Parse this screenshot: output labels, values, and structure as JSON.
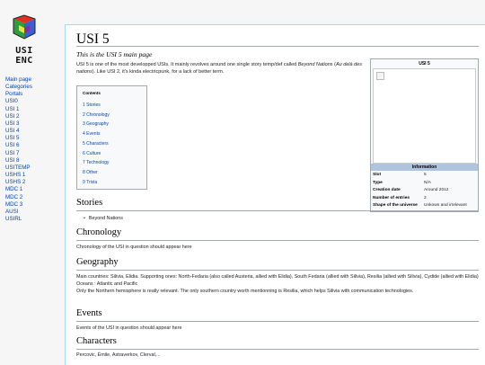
{
  "logo": {
    "line1": "USI",
    "line2": "ENC"
  },
  "nav": [
    "Main page",
    "Categories",
    "Portals",
    "USI0",
    "USI 1",
    "USI 2",
    "USI 3",
    "USI 4",
    "USI 5",
    "USI 6",
    "USI 7",
    "USI 8",
    "USITEMP",
    "USHS 1",
    "USHS 2",
    "MDC 1",
    "MDC 2",
    "MDC 3",
    "AUSI",
    "USIRL"
  ],
  "page": {
    "title": "USI 5",
    "tagline": "This is the USI 5 main page",
    "intro_a": "USI 5 is one of the most developped USIs. It mainly revolves around one single story temp/def called ",
    "intro_italic1": "Beyond Nations",
    "intro_b": " (",
    "intro_italic2": "Au delà des nations",
    "intro_c": "). Like USI 2, it's kinda electricpunk, for a lack of better term."
  },
  "toc": {
    "title": "Contents",
    "items": [
      "1 Stories",
      "2 Chronology",
      "3 Geography",
      "4 Events",
      "5 Characters",
      "6 Culture",
      "7 Technology",
      "8 Other",
      "9 Trivia"
    ]
  },
  "infobox": {
    "title": "USI 5",
    "header": "Information",
    "rows": [
      {
        "k": "Slot",
        "v": "5"
      },
      {
        "k": "Type",
        "v": "N/A"
      },
      {
        "k": "Creation date",
        "v": "Around 2012"
      },
      {
        "k": "Number of entries",
        "v": "2"
      },
      {
        "k": "Shape of the universe",
        "v": "Unkown and irrelevant"
      }
    ]
  },
  "sections": {
    "stories": {
      "title": "Stories",
      "bullet": "Beyond Nations"
    },
    "chronology": {
      "title": "Chronology",
      "text": "Chronology of the USI in question should appear here"
    },
    "geography": {
      "title": "Geography",
      "line1": "Main countries: Silivia, Elidia. Supporting ones: North-Fedaria (also called Austeria, allied with Elidia), South Fedaria (allied with Silivia), Resilia (allied with Silivia), Cydide (allied with Elidia)",
      "line2": "Oceans : Atlantic and Pacific",
      "line3": "Only the Northern hemisphere is really relevant. The only southern country worth mentionning is Resilia, which helps Silivia with communication technologies."
    },
    "events": {
      "title": "Events",
      "text": "Events of the USI in question should appear here"
    },
    "characters": {
      "title": "Characters",
      "text": "Percovic, Émile, Astraverkov, Clerval,..."
    }
  }
}
